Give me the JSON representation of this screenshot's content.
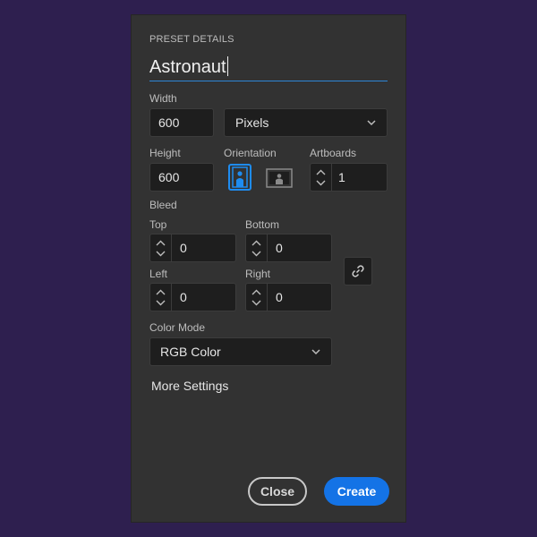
{
  "preset": {
    "section_title": "PRESET DETAILS",
    "name_value": "Astronaut"
  },
  "width": {
    "label": "Width",
    "value": "600",
    "unit_value": "Pixels"
  },
  "height": {
    "label": "Height",
    "value": "600"
  },
  "orientation": {
    "label": "Orientation",
    "selected": "portrait",
    "accent_color": "#1e8cf0"
  },
  "artboards": {
    "label": "Artboards",
    "value": "1"
  },
  "bleed": {
    "label": "Bleed",
    "top": {
      "label": "Top",
      "value": "0"
    },
    "bottom": {
      "label": "Bottom",
      "value": "0"
    },
    "left": {
      "label": "Left",
      "value": "0"
    },
    "right": {
      "label": "Right",
      "value": "0"
    }
  },
  "color_mode": {
    "label": "Color Mode",
    "value": "RGB Color"
  },
  "more_settings": "More Settings",
  "buttons": {
    "close": "Close",
    "create": "Create",
    "create_color": "#1473e6"
  }
}
